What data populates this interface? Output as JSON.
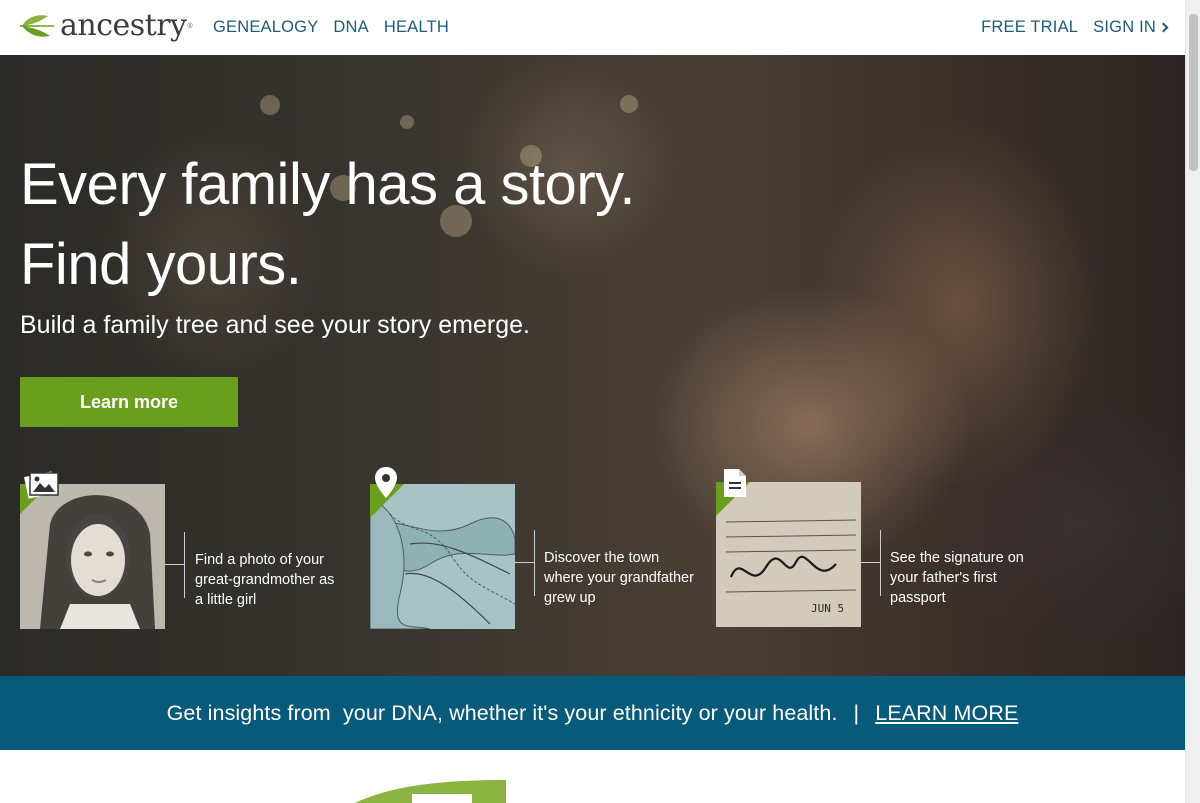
{
  "header": {
    "logo_text": "ancestry",
    "logo_mark": "®",
    "nav": [
      "GENEALOGY",
      "DNA",
      "HEALTH"
    ],
    "free_trial": "FREE TRIAL",
    "sign_in": "SIGN IN"
  },
  "hero": {
    "headline_line1": "Every family has a story.",
    "headline_line2": "Find yours.",
    "subheadline": "Build a family tree and see your story emerge.",
    "cta_label": "Learn more"
  },
  "features": [
    {
      "icon": "photos-icon",
      "text": "Find a photo of your great-grandmother as a little girl"
    },
    {
      "icon": "map-pin-icon",
      "text": "Discover the town where your grandfather grew up"
    },
    {
      "icon": "document-icon",
      "text": "See the signature on your father's first passport"
    }
  ],
  "banner": {
    "text": "Get insights from  your DNA, whether it's your ethnicity or your health.",
    "separator": "|",
    "link": "LEARN MORE"
  },
  "colors": {
    "brand_green": "#6a9e1f",
    "nav_blue": "#1e5d78",
    "banner_blue": "#075a7a"
  }
}
